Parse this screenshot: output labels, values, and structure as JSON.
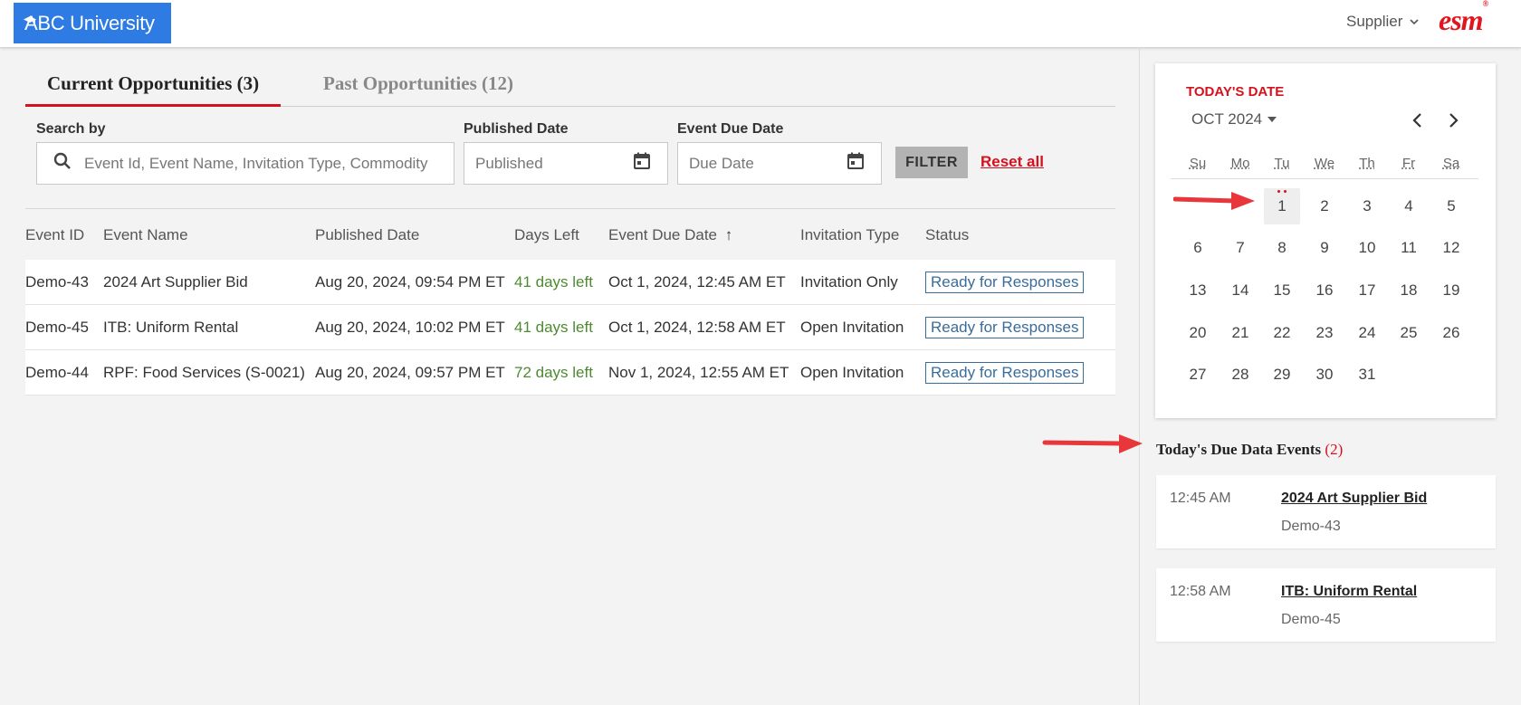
{
  "header": {
    "logo_text": "ABC University",
    "user_menu_label": "Supplier",
    "brand": "esm",
    "brand_mark": "®"
  },
  "tabs": [
    {
      "label": "Current Opportunities (3)",
      "active": true
    },
    {
      "label": "Past Opportunities (12)",
      "active": false
    }
  ],
  "filters": {
    "search_label": "Search by",
    "search_placeholder": "Event Id, Event Name, Invitation Type, Commodity",
    "published_label": "Published Date",
    "published_placeholder": "Published",
    "due_label": "Event Due Date",
    "due_placeholder": "Due Date",
    "filter_button": "FILTER",
    "reset_link": "Reset all"
  },
  "table": {
    "columns": [
      "Event ID",
      "Event Name",
      "Published Date",
      "Days Left",
      "Event Due Date",
      "Invitation Type",
      "Status"
    ],
    "sort_indicator": "↑",
    "rows": [
      {
        "id": "Demo-43",
        "name": "2024 Art Supplier Bid",
        "published": "Aug 20, 2024, 09:54 PM ET",
        "days_left": "41 days left",
        "due": "Oct 1, 2024, 12:45 AM ET",
        "invitation": "Invitation Only",
        "status": "Ready for Responses"
      },
      {
        "id": "Demo-45",
        "name": "ITB: Uniform Rental",
        "published": "Aug 20, 2024, 10:02 PM ET",
        "days_left": "41 days left",
        "due": "Oct 1, 2024, 12:58 AM ET",
        "invitation": "Open Invitation",
        "status": "Ready for Responses"
      },
      {
        "id": "Demo-44",
        "name": "RPF: Food Services (S-0021)",
        "published": "Aug 20, 2024, 09:57 PM ET",
        "days_left": "72 days left",
        "due": "Nov 1, 2024, 12:55 AM ET",
        "invitation": "Open Invitation",
        "status": "Ready for Responses"
      }
    ]
  },
  "calendar": {
    "title": "TODAY'S DATE",
    "month": "OCT 2024",
    "weekdays": [
      "Su",
      "Mo",
      "Tu",
      "We",
      "Th",
      "Fr",
      "Sa"
    ],
    "weeks": [
      [
        "",
        "",
        "1",
        "2",
        "3",
        "4",
        "5"
      ],
      [
        "6",
        "7",
        "8",
        "9",
        "10",
        "11",
        "12"
      ],
      [
        "13",
        "14",
        "15",
        "16",
        "17",
        "18",
        "19"
      ],
      [
        "20",
        "21",
        "22",
        "23",
        "24",
        "25",
        "26"
      ],
      [
        "27",
        "28",
        "29",
        "30",
        "31",
        "",
        ""
      ]
    ],
    "today": "1"
  },
  "due_events": {
    "heading": "Today's Due Data Events",
    "count": "(2)",
    "items": [
      {
        "time": "12:45 AM",
        "name": "2024 Art Supplier Bid",
        "id": "Demo-43"
      },
      {
        "time": "12:58 AM",
        "name": "ITB: Uniform Rental",
        "id": "Demo-45"
      }
    ]
  },
  "colors": {
    "accent_red": "#d4111c",
    "logo_blue": "#2d7be3",
    "days_green": "#4d8a30",
    "status_blue": "#3a6c9a"
  }
}
